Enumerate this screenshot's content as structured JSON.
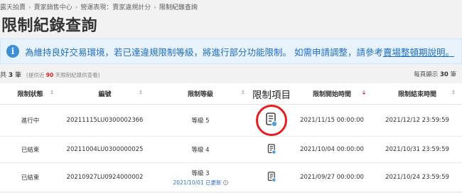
{
  "breadcrumb": [
    "露天拍賣",
    "賣家銷售中心",
    "營運表現：賣家違規計分",
    "限制紀錄查詢"
  ],
  "page_title": "限制紀錄查詢",
  "notice": {
    "icon": "info-icon",
    "text": "為維持良好交易環境，若已達違規限制等級，將進行部分功能限制。 如需申請調整，請參考",
    "link": "賣場整頓期說明。"
  },
  "summary": {
    "prefix": "共",
    "count": "3",
    "suffix": "筆",
    "note_before": "(提供近",
    "note_days": "90",
    "note_after": "天限制紀錄供查看)",
    "per_page_prefix": "每頁顯示",
    "per_page_value": "30",
    "per_page_suffix": "筆"
  },
  "columns": [
    "限制狀態",
    "編號",
    "限制等級",
    "限制項目",
    "限制開始時間",
    "限制結束時間"
  ],
  "rows": [
    {
      "status": "進行中",
      "id": "20211115LU0300002366",
      "level": "等級 5",
      "update": "",
      "start": "2021/11/15 00:00:00",
      "end": "2021/12/12 23:59:59"
    },
    {
      "status": "已結束",
      "id": "20211004LU0300000025",
      "level": "等級 4",
      "update": "",
      "start": "2021/10/04 00:00:00",
      "end": "2021/10/31 23:59:59"
    },
    {
      "status": "已結束",
      "id": "20210927LU0924000002",
      "level": "等級 3",
      "update": "2021/10/01 已更新",
      "start": "2021/09/27 00:00:00",
      "end": "2021/10/24 23:59:59"
    }
  ],
  "colors": {
    "accent": "#1f6fbf",
    "highlight": "#e32020",
    "notice_bg": "#e8f2fb"
  }
}
